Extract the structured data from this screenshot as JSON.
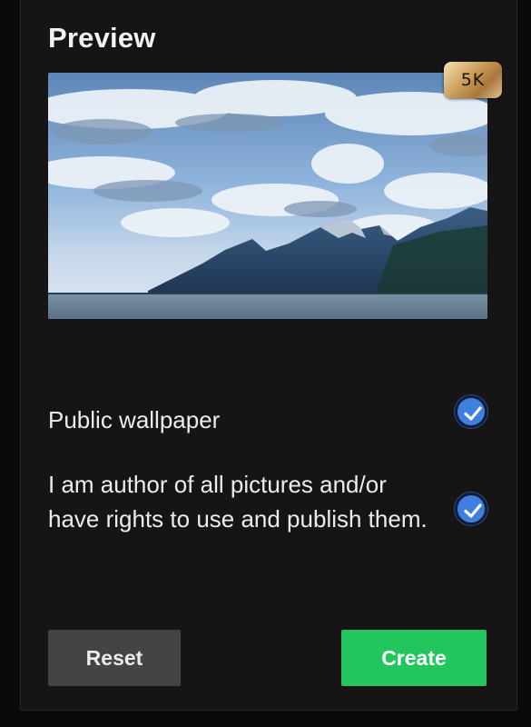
{
  "panel": {
    "title": "Preview",
    "resolution_badge": "5K"
  },
  "options": [
    {
      "label": "Public wallpaper",
      "checked": true
    },
    {
      "label": "I am author of all pictures and/or have rights to use and publish them.",
      "checked": true
    }
  ],
  "buttons": {
    "reset_label": "Reset",
    "create_label": "Create"
  },
  "colors": {
    "panel_bg": "#171416",
    "checkbox": "#3f7fe0",
    "create_button": "#22c55e",
    "reset_button": "#454345",
    "badge": "#c99a55"
  },
  "icons": [
    "checkmark-icon"
  ]
}
